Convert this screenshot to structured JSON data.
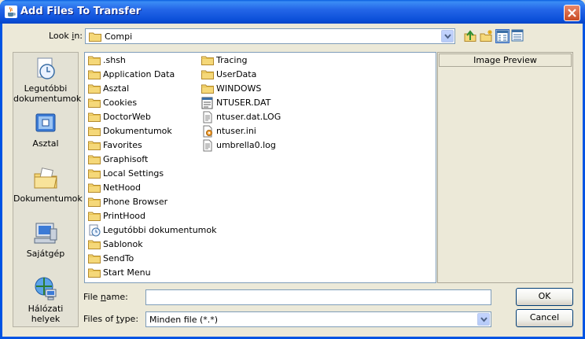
{
  "window": {
    "title": "Add Files To Transfer"
  },
  "lookin": {
    "label_pre": "Look ",
    "label_mn": "i",
    "label_post": "n:",
    "value": "Compi"
  },
  "places": [
    {
      "label": "Legutóbbi dokumentumok",
      "icon": "recent-docs-icon"
    },
    {
      "label": "Asztal",
      "icon": "desktop-icon"
    },
    {
      "label": "Dokumentumok",
      "icon": "my-documents-icon"
    },
    {
      "label": "Sajátgép",
      "icon": "my-computer-icon"
    },
    {
      "label": "Hálózati helyek",
      "icon": "network-places-icon"
    }
  ],
  "files": {
    "col1": [
      {
        "name": ".shsh",
        "type": "folder"
      },
      {
        "name": "Application Data",
        "type": "folder"
      },
      {
        "name": "Asztal",
        "type": "folder"
      },
      {
        "name": "Cookies",
        "type": "folder"
      },
      {
        "name": "DoctorWeb",
        "type": "folder"
      },
      {
        "name": "Dokumentumok",
        "type": "folder"
      },
      {
        "name": "Favorites",
        "type": "folder"
      },
      {
        "name": "Graphisoft",
        "type": "folder"
      },
      {
        "name": "Local Settings",
        "type": "folder"
      },
      {
        "name": "NetHood",
        "type": "folder"
      },
      {
        "name": "Phone Browser",
        "type": "folder"
      },
      {
        "name": "PrintHood",
        "type": "folder"
      },
      {
        "name": "Legutóbbi dokumentumok",
        "type": "recent"
      },
      {
        "name": "Sablonok",
        "type": "folder"
      },
      {
        "name": "SendTo",
        "type": "folder"
      },
      {
        "name": "Start Menu",
        "type": "folder"
      }
    ],
    "col2": [
      {
        "name": "Tracing",
        "type": "folder"
      },
      {
        "name": "UserData",
        "type": "folder"
      },
      {
        "name": "WINDOWS",
        "type": "folder"
      },
      {
        "name": "NTUSER.DAT",
        "type": "dat"
      },
      {
        "name": "ntuser.dat.LOG",
        "type": "text"
      },
      {
        "name": "ntuser.ini",
        "type": "ini"
      },
      {
        "name": "umbrella0.log",
        "type": "text"
      }
    ]
  },
  "preview": {
    "header": "Image Preview"
  },
  "filename": {
    "label_pre": "File ",
    "label_mn": "n",
    "label_post": "ame:",
    "value": ""
  },
  "filetype": {
    "label_pre": "Files of ",
    "label_mn": "t",
    "label_post": "ype:",
    "value": "Minden file (*.*)"
  },
  "buttons": {
    "ok": "OK",
    "cancel": "Cancel"
  },
  "colors": {
    "titlebar": "#0054E3",
    "folder": "#F5D879",
    "dialog_bg": "#ECE9D8"
  }
}
